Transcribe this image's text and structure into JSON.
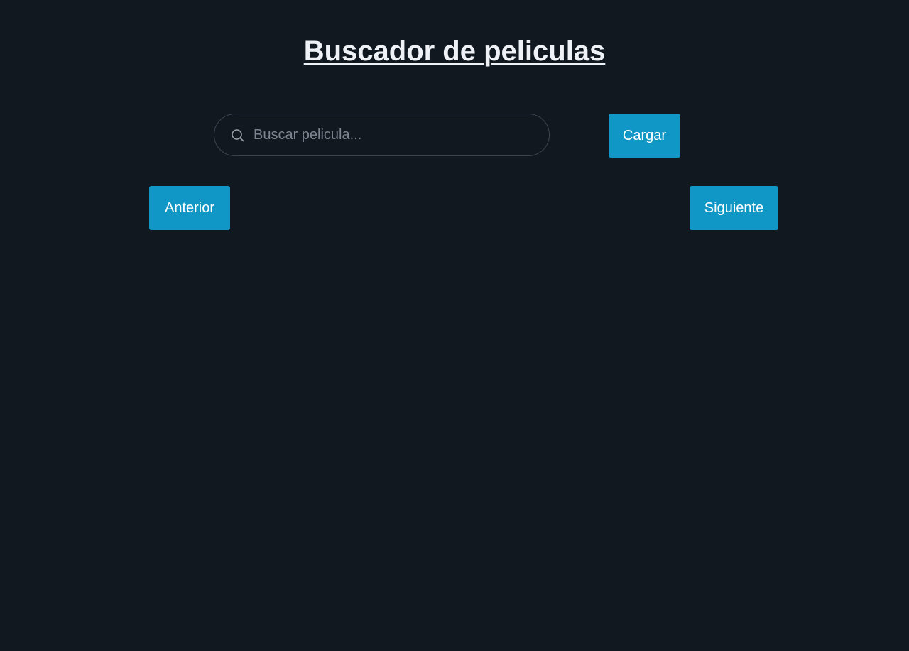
{
  "header": {
    "title": "Buscador de peliculas"
  },
  "search": {
    "placeholder": "Buscar pelicula...",
    "value": "",
    "icon": "search-icon",
    "load_label": "Cargar"
  },
  "pagination": {
    "prev_label": "Anterior",
    "next_label": "Siguiente"
  },
  "colors": {
    "background": "#121820",
    "accent": "#1197c5",
    "text": "#eef2f6"
  }
}
